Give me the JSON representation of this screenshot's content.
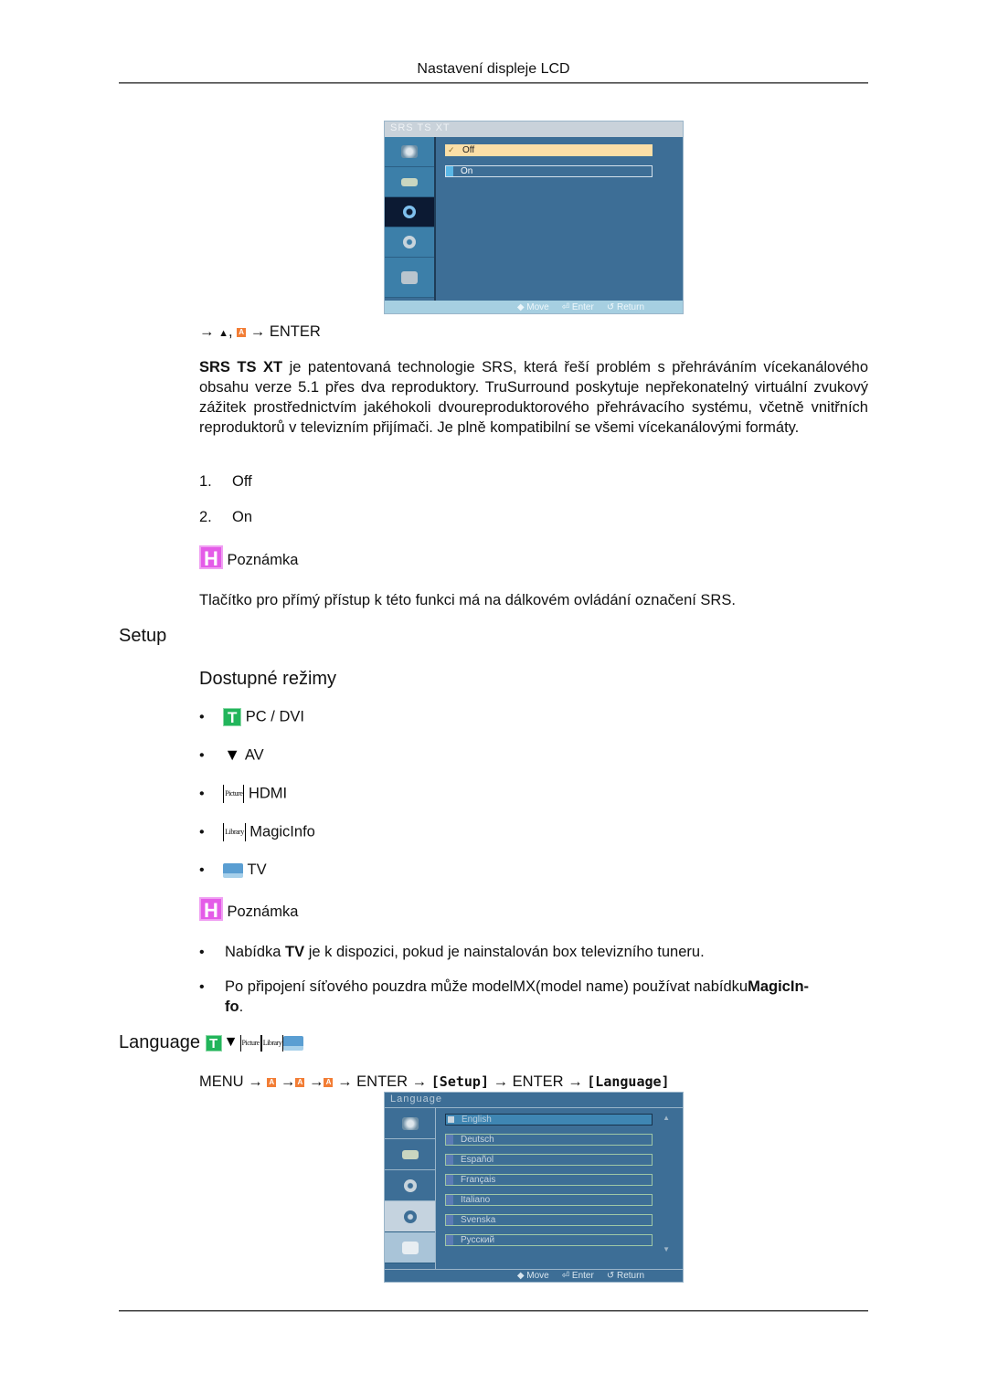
{
  "header": {
    "title": "Nastavení displeje LCD"
  },
  "srs_menu": {
    "title": "SRS TS XT",
    "sidebar_icons": [
      "picture-icon",
      "sound-source-icon",
      "sound-icon",
      "setup-gear-icon",
      "multi-control-icon"
    ],
    "active_sidebar_index": 2,
    "options": [
      {
        "label": "Off",
        "selected": true
      },
      {
        "label": "On",
        "selected": false
      }
    ],
    "footer": {
      "move": "Move",
      "enter": "Enter",
      "return": "Return"
    }
  },
  "srs_section": {
    "navigation": {
      "arrow": "→",
      "sep": ",",
      "enter": "→ ENTER"
    },
    "description_bold": "SRS TS XT",
    "description": " je patentovaná technologie SRS, která řeší problém s přehráváním vícekanálového obsahu verze 5.1 přes dva reproduktory. TruSurround poskytuje nepřekonatelný virtuální zvukový zážitek prostřednictvím jakéhokoli dvoureproduktorového přehrávacího systému, včetně vnitřních reproduktorů v televizním přijímači. Je plně kompatibilní se všemi vícekanálovými formáty.",
    "options": [
      {
        "num": "1.",
        "label": "Off"
      },
      {
        "num": "2.",
        "label": "On"
      }
    ],
    "note_label": "Poznámka",
    "note_text": "Tlačítko pro přímý přístup k této funkci má na dálkovém ovládání označení SRS."
  },
  "setup_section": {
    "title": "Setup",
    "subtitle": "Dostupné režimy",
    "modes": [
      {
        "icon": "pc-dvi-icon",
        "label": "PC / DVI"
      },
      {
        "icon": "av-icon",
        "label": "AV"
      },
      {
        "icon": "hdmi-icon",
        "label": "HDMI",
        "icon_text": "Picture"
      },
      {
        "icon": "magicinfo-icon",
        "label": "MagicInfo",
        "icon_text": "Library"
      },
      {
        "icon": "tv-icon",
        "label": "TV"
      }
    ],
    "note_label": "Poznámka",
    "notes": [
      {
        "pre": "Nabídka ",
        "bold": "TV",
        "post": " je k dispozici, pokud je nainstalován box televizního tuneru."
      },
      {
        "pre": "Po připojení síťového pouzdra může modelMX(model name) používat nabídku",
        "bold": "MagicIn-\nfo",
        "post": "."
      }
    ]
  },
  "language_section": {
    "title": "Language",
    "title_icons": [
      "pc-dvi-icon",
      "av-icon",
      "hdmi-icon",
      "magicinfo-icon",
      "tv-icon"
    ],
    "title_icon_texts": {
      "hdmi": "Picture",
      "magicinfo": "Library"
    },
    "navigation": {
      "menu": "MENU",
      "arrow": "→",
      "enter": "ENTER",
      "setup": "[Setup]",
      "language": "[Language]"
    }
  },
  "language_menu": {
    "title": "Language",
    "options": [
      {
        "label": "English",
        "selected": true
      },
      {
        "label": "Deutsch",
        "selected": false
      },
      {
        "label": "Español",
        "selected": false
      },
      {
        "label": "Français",
        "selected": false
      },
      {
        "label": "Italiano",
        "selected": false
      },
      {
        "label": "Svenska",
        "selected": false
      },
      {
        "label": "Русский",
        "selected": false
      }
    ],
    "footer": {
      "move": "Move",
      "enter": "Enter",
      "return": "Return"
    }
  }
}
